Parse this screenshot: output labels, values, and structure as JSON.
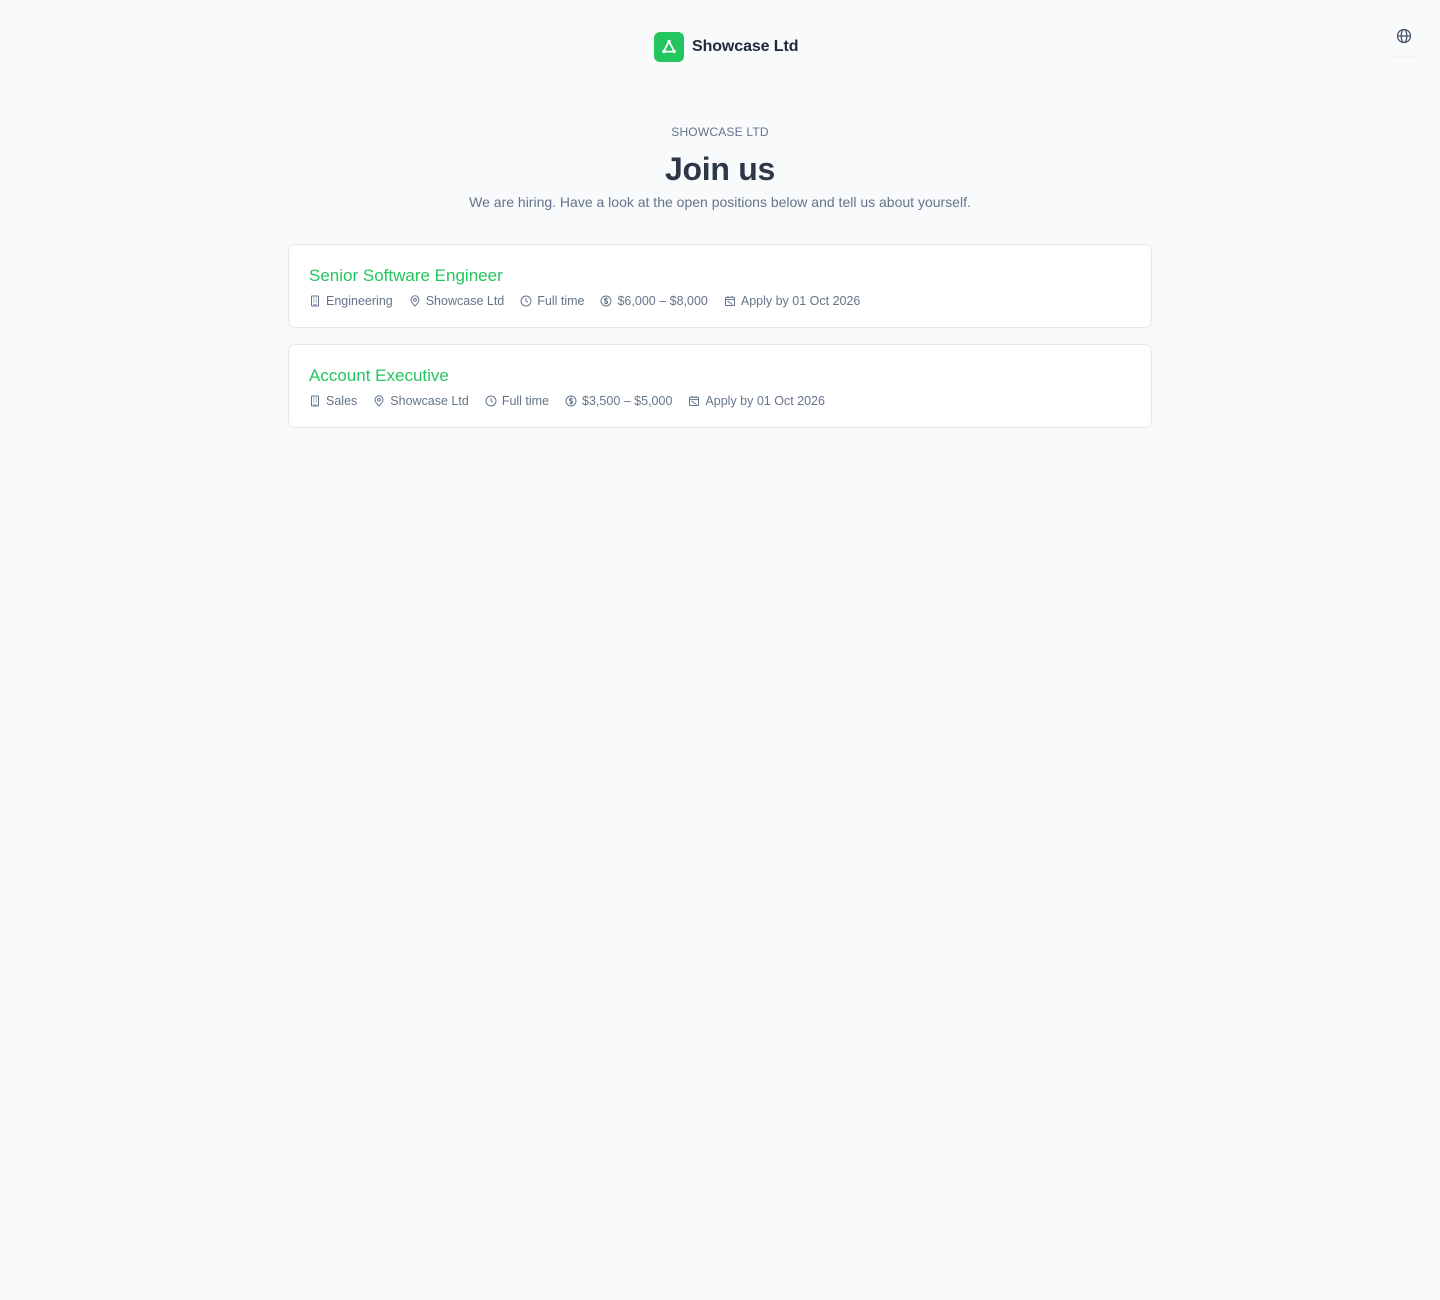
{
  "header": {
    "brand_name": "Showcase Ltd",
    "brand_icon": "logo-triangle-icon",
    "language_icon": "globe-icon"
  },
  "hero": {
    "eyebrow": "SHOWCASE LTD",
    "title": "Join us",
    "subtitle": "We are hiring. Have a look at the open positions below and tell us about yourself."
  },
  "jobs": [
    {
      "title": "Senior Software Engineer",
      "department": "Engineering",
      "location": "Showcase Ltd",
      "employment_type": "Full time",
      "salary": "$6,000 – $8,000",
      "deadline": "Apply by 01 Oct 2026"
    },
    {
      "title": "Account Executive",
      "department": "Sales",
      "location": "Showcase Ltd",
      "employment_type": "Full time",
      "salary": "$3,500 – $5,000",
      "deadline": "Apply by 01 Oct 2026"
    }
  ],
  "colors": {
    "accent": "#22c55e",
    "background": "#f8fafc",
    "text_primary": "#2d3748",
    "text_muted": "#64748b",
    "card_border": "#e2e8f0"
  }
}
